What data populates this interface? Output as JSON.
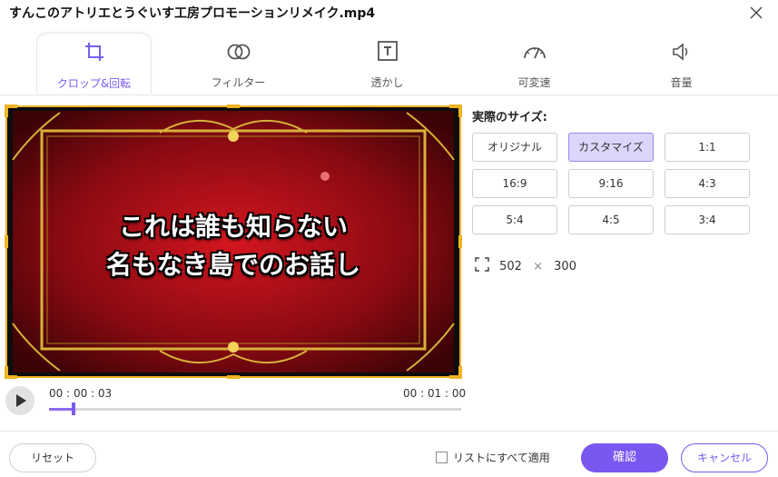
{
  "window": {
    "title": "すんこのアトリエとうぐいす工房プロモーションリメイク.mp4",
    "close_icon": "close-icon"
  },
  "tabs": [
    {
      "label": "クロップ&回転",
      "icon": "crop-icon",
      "active": true
    },
    {
      "label": "フィルター",
      "icon": "filter-icon",
      "active": false
    },
    {
      "label": "透かし",
      "icon": "watermark-icon",
      "active": false
    },
    {
      "label": "可変速",
      "icon": "speed-icon",
      "active": false
    },
    {
      "label": "音量",
      "icon": "volume-icon",
      "active": false
    }
  ],
  "preview": {
    "caption_line1": "これは誰も知らない",
    "caption_line2": "名もなき島でのお話し",
    "frame_color": "#f0b323"
  },
  "playback": {
    "current_time": "00 : 00 : 03",
    "total_time": "00 : 01 : 00",
    "progress": 0.06,
    "accent": "#7a5cf0"
  },
  "crop_panel": {
    "title": "実際のサイズ:",
    "ratios": [
      "オリジナル",
      "カスタマイズ",
      "1:1",
      "16:9",
      "9:16",
      "4:3",
      "5:4",
      "4:5",
      "3:4"
    ],
    "selected_ratio": "カスタマイズ",
    "width": "502",
    "height": "300"
  },
  "footer": {
    "reset_label": "リセット",
    "apply_all_label": "リストにすべて適用",
    "apply_all_checked": false,
    "ok_label": "確認",
    "cancel_label": "キャンセル"
  }
}
